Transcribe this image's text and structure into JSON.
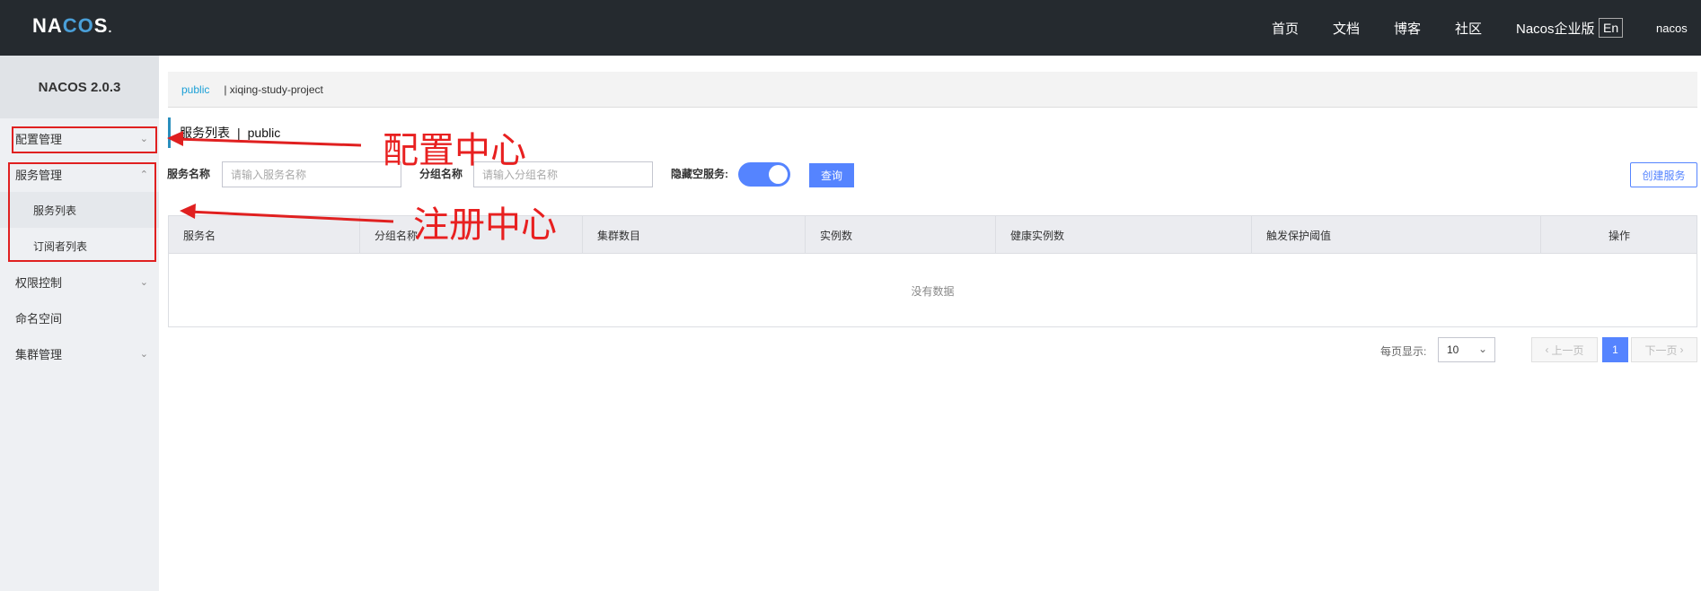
{
  "brand": {
    "logo": "NACOS."
  },
  "topnav": {
    "items": [
      "首页",
      "文档",
      "博客",
      "社区",
      "Nacos企业版"
    ],
    "lang": "En",
    "user": "nacos"
  },
  "sidebar": {
    "title": "NACOS 2.0.3",
    "items": [
      {
        "label": "配置管理",
        "chevron": "down"
      },
      {
        "label": "服务管理",
        "chevron": "up"
      },
      {
        "label": "权限控制",
        "chevron": "down"
      },
      {
        "label": "命名空间"
      },
      {
        "label": "集群管理",
        "chevron": "down"
      }
    ],
    "subitems": [
      "服务列表",
      "订阅者列表"
    ]
  },
  "namespace_bar": {
    "active": "public",
    "other": "| xiqing-study-project"
  },
  "page": {
    "title": "服务列表",
    "separator": "|",
    "namespace": "public"
  },
  "filters": {
    "service_name_label": "服务名称",
    "service_name_placeholder": "请输入服务名称",
    "group_name_label": "分组名称",
    "group_name_placeholder": "请输入分组名称",
    "hide_empty_label": "隐藏空服务:",
    "hide_empty_on": true,
    "query_button": "查询",
    "create_button": "创建服务"
  },
  "table": {
    "columns": [
      "服务名",
      "分组名称",
      "集群数目",
      "实例数",
      "健康实例数",
      "触发保护阈值",
      "操作"
    ],
    "rows": [],
    "empty_text": "没有数据"
  },
  "pagination": {
    "page_size_label": "每页显示:",
    "page_size": "10",
    "prev": "上一页",
    "next": "下一页",
    "current": "1"
  },
  "annotations": {
    "config_center": "配置中心",
    "registry_center": "注册中心"
  },
  "colors": {
    "topbar": "#252a2f",
    "primary": "#5584ff",
    "annotation": "#e02020",
    "link": "#1a9fd6"
  }
}
